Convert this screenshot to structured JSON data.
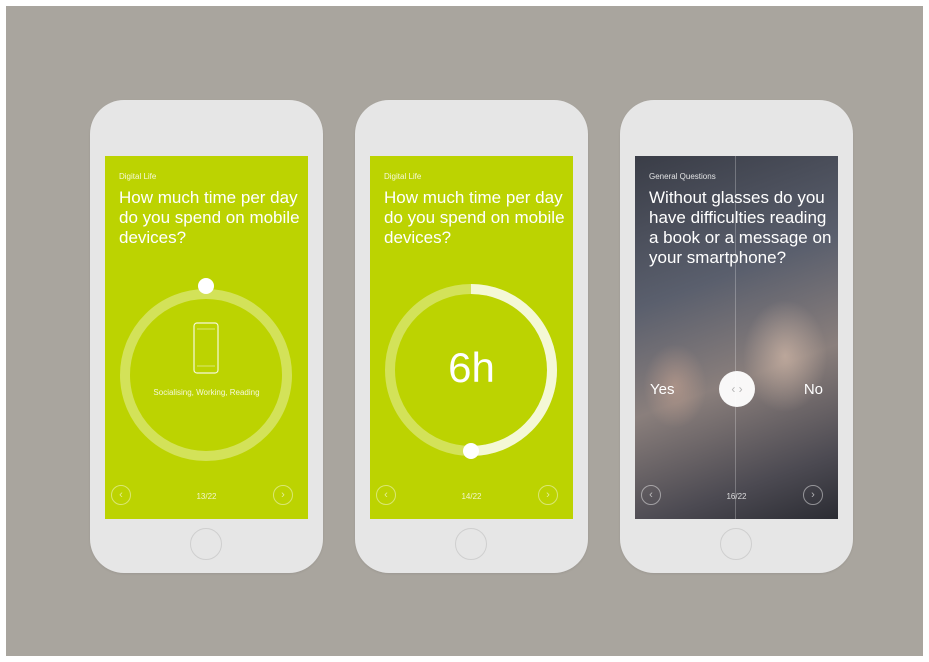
{
  "screens": [
    {
      "section": "Digital Life",
      "question": "How much time per day do you spend on mobile devices?",
      "device_caption": "Socialising, Working, Reading",
      "counter": "13/22",
      "prev_icon": "chevron-left-icon",
      "next_icon": "chevron-right-icon",
      "dial_value_fraction": 0
    },
    {
      "section": "Digital Life",
      "question": "How much time per day do you spend on mobile devices?",
      "value_label": "6h",
      "counter": "14/22",
      "prev_icon": "chevron-left-icon",
      "next_icon": "chevron-right-icon",
      "dial_value_fraction": 0.5
    },
    {
      "section": "General Questions",
      "question": "Without glasses do you have difficulties reading a book or a message on your smartphone?",
      "yes_label": "Yes",
      "no_label": "No",
      "slider_glyphs": "‹ ›",
      "counter": "16/22",
      "prev_icon": "chevron-left-icon",
      "next_icon": "chevron-right-icon"
    }
  ],
  "colors": {
    "background": "#a9a59e",
    "accent_green": "#bcd301",
    "phone_body": "#e6e6e6"
  },
  "prev_glyph": "‹",
  "next_glyph": "›"
}
